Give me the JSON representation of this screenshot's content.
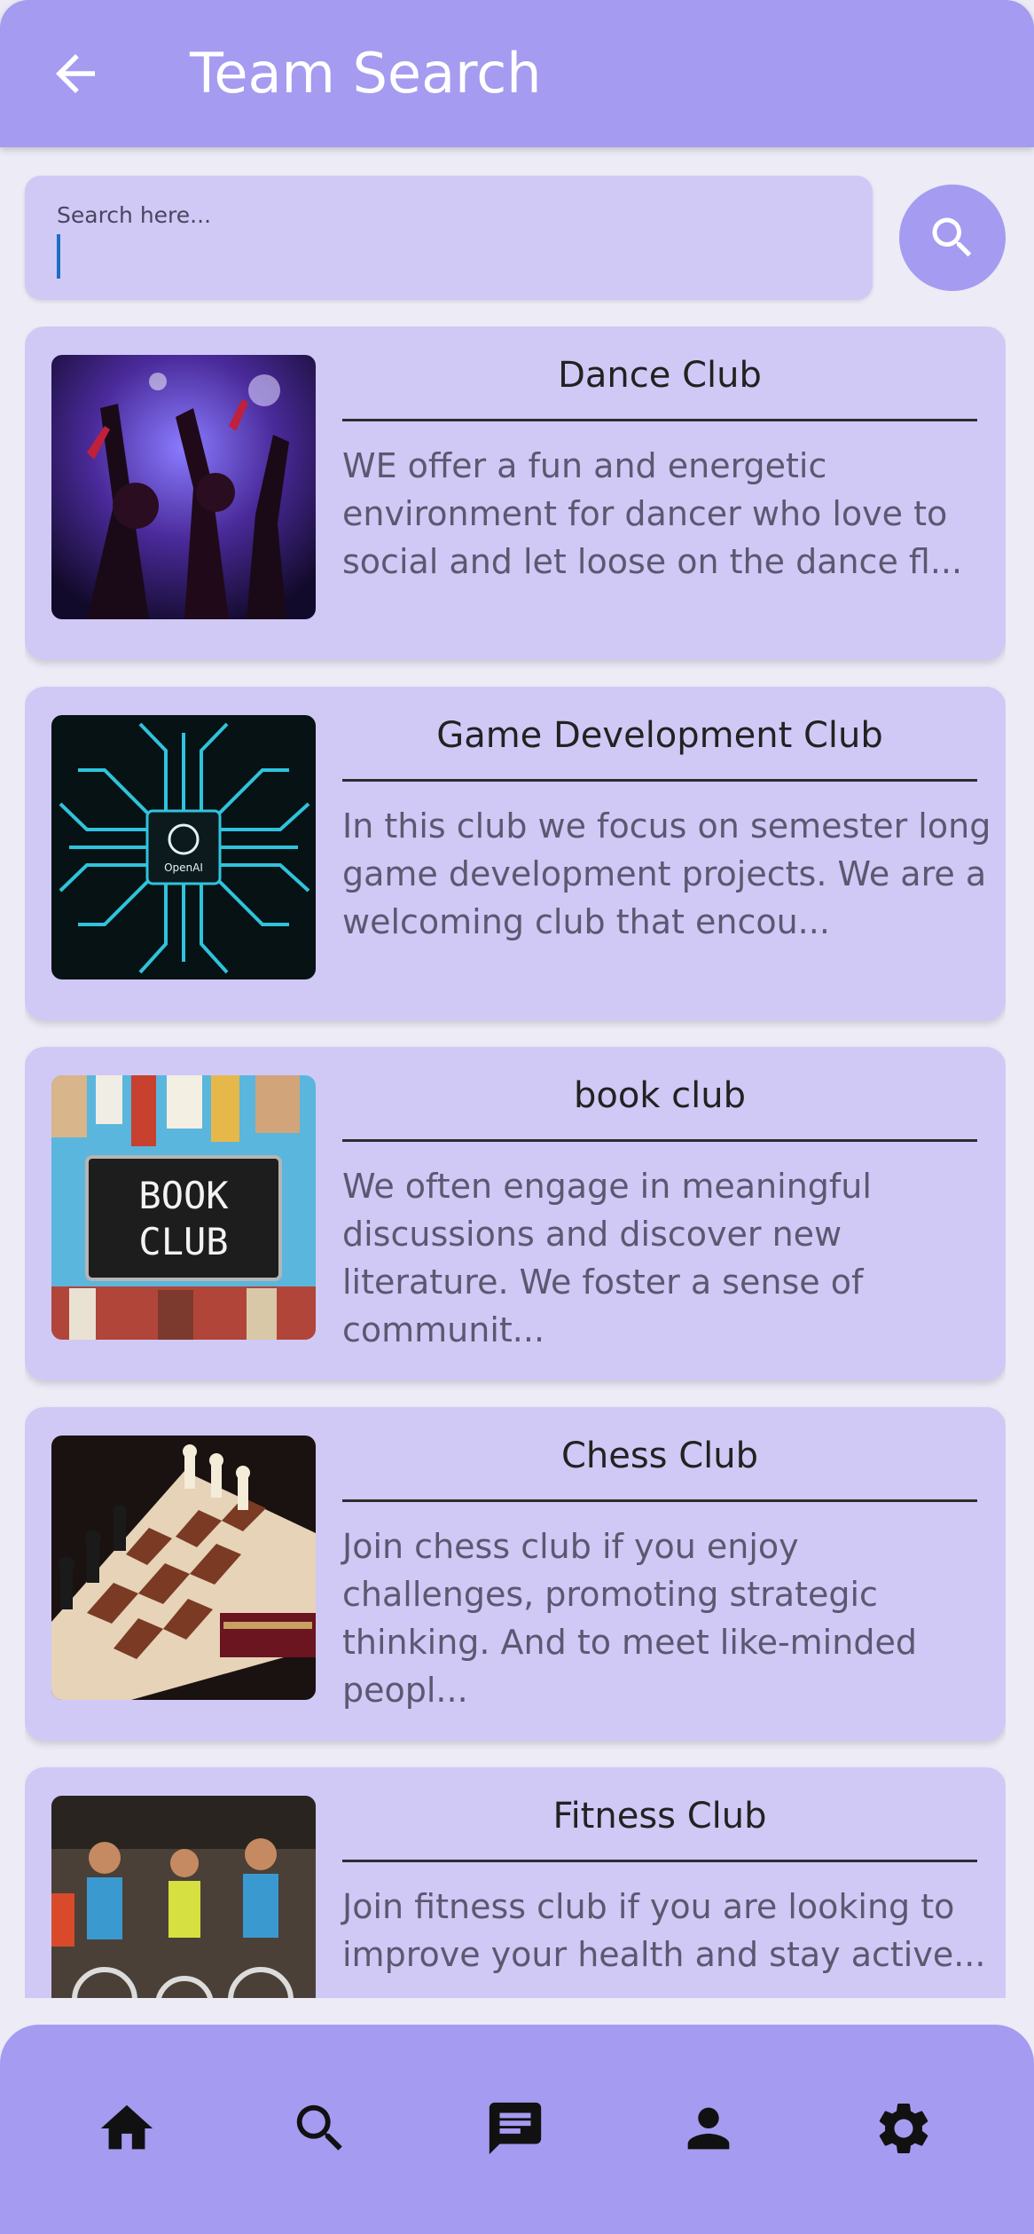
{
  "appbar": {
    "title": "Team Search",
    "back_icon": "arrow-left-icon"
  },
  "search": {
    "placeholder": "Search here...",
    "button_icon": "search-icon"
  },
  "clubs": [
    {
      "name": "Dance Club",
      "description": "WE offer a fun and energetic environment for dancer who love to social and let loose on the dance fl...",
      "image": "dance-party-photo"
    },
    {
      "name": "Game Development Club",
      "description": "In this club we focus on semester long game development projects. We are a welcoming club that encou...",
      "image": "circuit-chip-photo",
      "image_chip_label": "OpenAI"
    },
    {
      "name": "book club",
      "description": "We often engage in meaningful discussions and discover new literature. We foster a sense of communit...",
      "image": "book-club-sign-photo",
      "image_sign_line1": "BOOK",
      "image_sign_line2": "CLUB"
    },
    {
      "name": "Chess Club",
      "description": "Join chess club if you enjoy challenges, promoting strategic thinking. And to meet like-minded peopl...",
      "image": "chess-board-photo"
    },
    {
      "name": "Fitness Club",
      "description": "Join fitness club if you are looking to improve your health and stay active...",
      "image": "spin-class-photo"
    }
  ],
  "nav": [
    {
      "icon": "home-icon"
    },
    {
      "icon": "search-icon"
    },
    {
      "icon": "chat-icon"
    },
    {
      "icon": "person-icon"
    },
    {
      "icon": "gear-icon"
    }
  ],
  "colors": {
    "primary": "#a59bf0",
    "card": "#d0c9f6",
    "background": "#ecebf6"
  }
}
